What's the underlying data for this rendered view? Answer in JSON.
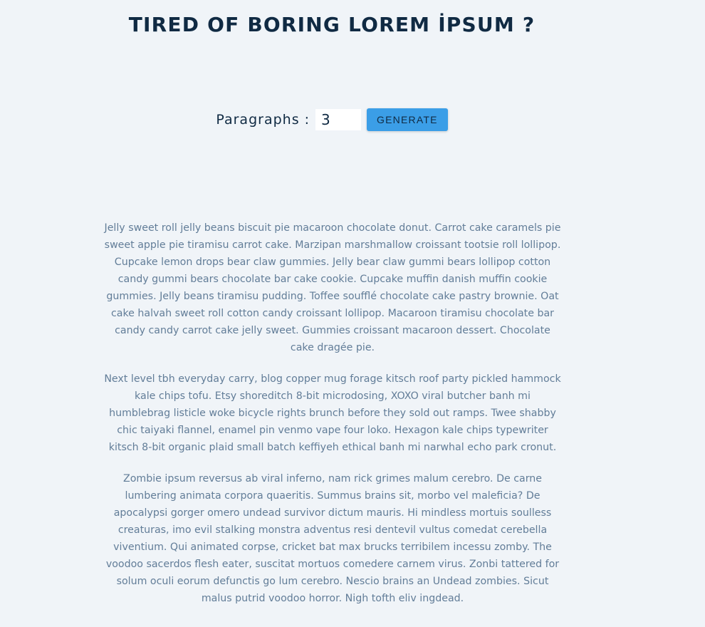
{
  "header": {
    "title": "TIRED OF BORING LOREM İPSUM ?"
  },
  "form": {
    "label": "Paragraphs :",
    "input_value": "3",
    "button_label": "GENERATE"
  },
  "content": {
    "paragraphs": [
      "Jelly sweet roll jelly beans biscuit pie macaroon chocolate donut. Carrot cake caramels pie sweet apple pie tiramisu carrot cake. Marzipan marshmallow croissant tootsie roll lollipop. Cupcake lemon drops bear claw gummies. Jelly bear claw gummi bears lollipop cotton candy gummi bears chocolate bar cake cookie. Cupcake muffin danish muffin cookie gummies. Jelly beans tiramisu pudding. Toffee soufflé chocolate cake pastry brownie. Oat cake halvah sweet roll cotton candy croissant lollipop. Macaroon tiramisu chocolate bar candy candy carrot cake jelly sweet. Gummies croissant macaroon dessert. Chocolate cake dragée pie.",
      "Next level tbh everyday carry, blog copper mug forage kitsch roof party pickled hammock kale chips tofu. Etsy shoreditch 8-bit microdosing, XOXO viral butcher banh mi humblebrag listicle woke bicycle rights brunch before they sold out ramps. Twee shabby chic taiyaki flannel, enamel pin venmo vape four loko. Hexagon kale chips typewriter kitsch 8-bit organic plaid small batch keffiyeh ethical banh mi narwhal echo park cronut.",
      "Zombie ipsum reversus ab viral inferno, nam rick grimes malum cerebro. De carne lumbering animata corpora quaeritis. Summus brains sit, morbo vel maleficia? De apocalypsi gorger omero undead survivor dictum mauris. Hi mindless mortuis soulless creaturas, imo evil stalking monstra adventus resi dentevil vultus comedat cerebella viventium. Qui animated corpse, cricket bat max brucks terribilem incessu zomby. The voodoo sacerdos flesh eater, suscitat mortuos comedere carnem virus. Zonbi tattered for solum oculi eorum defunctis go lum cerebro. Nescio brains an Undead zombies. Sicut malus putrid voodoo horror. Nigh tofth eliv ingdead."
    ]
  },
  "colors": {
    "background": "#f0f4f8",
    "title": "#102a43",
    "button": "#3b9ee7",
    "paragraph_text": "#627d98"
  }
}
